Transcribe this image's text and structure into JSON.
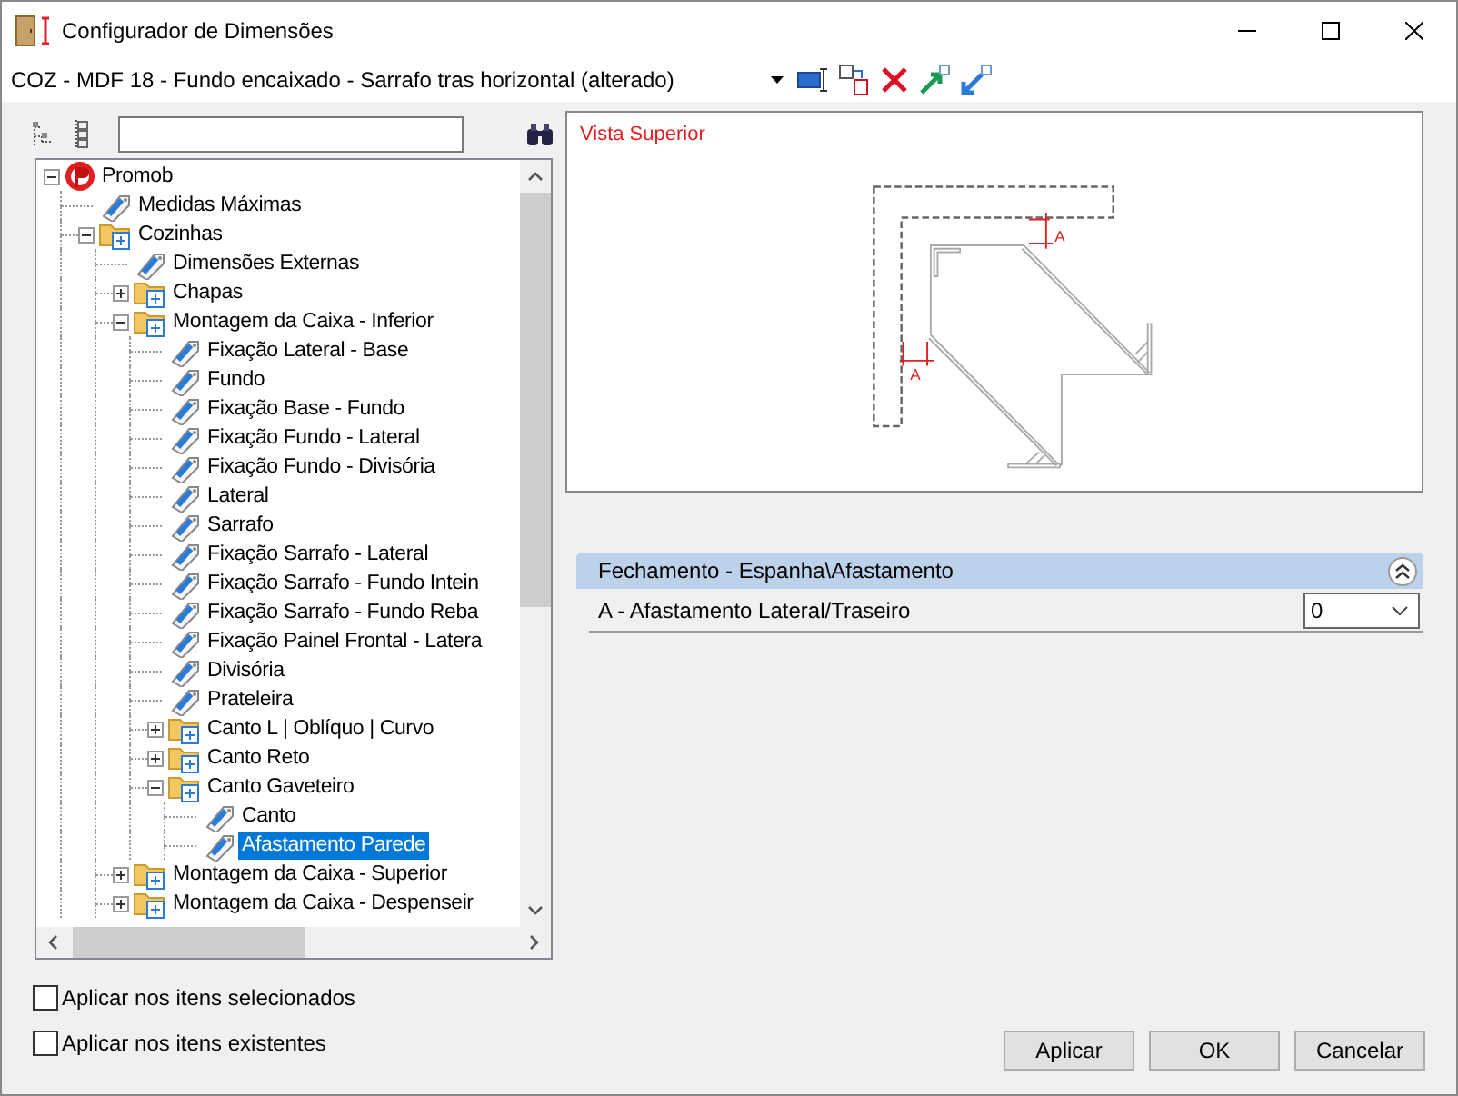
{
  "window": {
    "title": "Configurador de Dimensões"
  },
  "document": {
    "value": "COZ - MDF 18 - Fundo encaixado - Sarrafo tras horizontal (alterado)"
  },
  "tree": [
    {
      "label": "Promob",
      "kind": "root",
      "expanded": true,
      "selected": false,
      "children": [
        {
          "label": "Medidas Máximas",
          "kind": "leaf",
          "selected": false
        },
        {
          "label": "Cozinhas",
          "kind": "folder",
          "expanded": true,
          "selected": false,
          "children": [
            {
              "label": "Dimensões Externas",
              "kind": "leaf",
              "selected": false
            },
            {
              "label": "Chapas",
              "kind": "folder",
              "expanded": false,
              "selected": false
            },
            {
              "label": "Montagem da Caixa - Inferior",
              "kind": "folder",
              "expanded": true,
              "selected": false,
              "children": [
                {
                  "label": "Fixação Lateral - Base",
                  "kind": "leaf",
                  "selected": false
                },
                {
                  "label": "Fundo",
                  "kind": "leaf",
                  "selected": false
                },
                {
                  "label": "Fixação Base - Fundo",
                  "kind": "leaf",
                  "selected": false
                },
                {
                  "label": "Fixação Fundo - Lateral",
                  "kind": "leaf",
                  "selected": false
                },
                {
                  "label": "Fixação Fundo - Divisória",
                  "kind": "leaf",
                  "selected": false
                },
                {
                  "label": "Lateral",
                  "kind": "leaf",
                  "selected": false
                },
                {
                  "label": "Sarrafo",
                  "kind": "leaf",
                  "selected": false
                },
                {
                  "label": "Fixação Sarrafo - Lateral",
                  "kind": "leaf",
                  "selected": false
                },
                {
                  "label": "Fixação Sarrafo - Fundo Intein",
                  "kind": "leaf",
                  "selected": false
                },
                {
                  "label": "Fixação Sarrafo - Fundo Reba",
                  "kind": "leaf",
                  "selected": false
                },
                {
                  "label": "Fixação Painel Frontal - Latera",
                  "kind": "leaf",
                  "selected": false
                },
                {
                  "label": "Divisória",
                  "kind": "leaf",
                  "selected": false
                },
                {
                  "label": "Prateleira",
                  "kind": "leaf",
                  "selected": false
                },
                {
                  "label": "Canto L | Oblíquo | Curvo",
                  "kind": "folder",
                  "expanded": false,
                  "selected": false
                },
                {
                  "label": "Canto Reto",
                  "kind": "folder",
                  "expanded": false,
                  "selected": false
                },
                {
                  "label": "Canto Gaveteiro",
                  "kind": "folder",
                  "expanded": true,
                  "selected": false,
                  "children": [
                    {
                      "label": "Canto",
                      "kind": "leaf",
                      "selected": false
                    },
                    {
                      "label": "Afastamento Parede",
                      "kind": "leaf",
                      "selected": true
                    }
                  ]
                }
              ]
            },
            {
              "label": "Montagem da Caixa - Superior",
              "kind": "folder",
              "expanded": false,
              "selected": false
            },
            {
              "label": "Montagem da Caixa - Despenseir",
              "kind": "folder",
              "expanded": false,
              "selected": false
            }
          ]
        }
      ]
    }
  ],
  "view": {
    "title": "Vista Superior",
    "dim_label": "A",
    "dim_label_2": "A"
  },
  "properties": {
    "group": "Fechamento - Espanha\\Afastamento",
    "expanded": true,
    "rows": [
      {
        "label": "A - Afastamento Lateral/Traseiro",
        "value": "0"
      }
    ]
  },
  "options": [
    {
      "label": "Aplicar nos itens selecionados",
      "checked": false
    },
    {
      "label": "Aplicar nos itens existentes",
      "checked": false
    }
  ],
  "buttons": [
    "Aplicar",
    "OK",
    "Cancelar"
  ]
}
